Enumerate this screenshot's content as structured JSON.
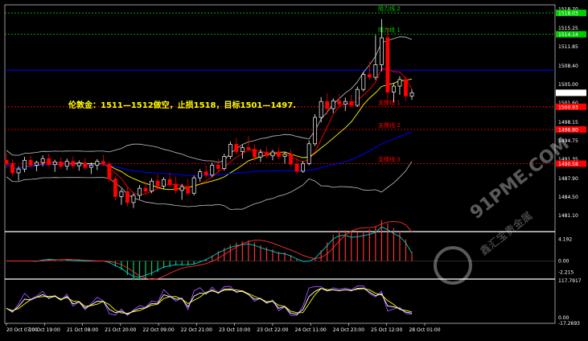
{
  "annotation": "伦敦金：1511—1512做空，止损1518，目标1501—1497.",
  "watermark": {
    "brand": "91PME.COM",
    "sub": "鑫汇宝贵金属"
  },
  "colors": {
    "background": "#000000",
    "bull": "#ffffff",
    "bear": "#ff0000",
    "resistance": "#00cc00",
    "support": "#ff0000",
    "blue_level": "#0000ff",
    "bollinger": "#c0c0c0",
    "ma_fast": "#ff0000",
    "ma_mid": "#ffff00",
    "ma_slow": "#0000ff",
    "annotation": "#ffff00"
  },
  "chart_data": [
    {
      "type": "candlestick",
      "ylim": [
        1478.5,
        1519.5
      ],
      "y_ticks": [
        "1518.70",
        "1515.25",
        "1511.85",
        "1508.40",
        "1505.00",
        "1501.60",
        "1498.15",
        "1494.75",
        "1491.35",
        "1487.90",
        "1484.50",
        "1481.10"
      ],
      "y_tick_values": [
        1518.7,
        1515.25,
        1511.85,
        1508.4,
        1505.0,
        1501.6,
        1498.15,
        1494.75,
        1491.35,
        1487.9,
        1484.5,
        1481.1
      ],
      "price_badges": [
        {
          "text": "1518.03",
          "value": 1518.03,
          "color": "#00cc00"
        },
        {
          "text": "1514.14",
          "value": 1514.14,
          "color": "#00cc00"
        },
        {
          "text": "1503.48",
          "value": 1503.48,
          "color": "#ffffff"
        },
        {
          "text": "1500.93",
          "value": 1500.93,
          "color": "#ff0000"
        },
        {
          "text": "1496.80",
          "value": 1496.8,
          "color": "#ff0000"
        },
        {
          "text": "1490.58",
          "value": 1490.58,
          "color": "#ff0000"
        }
      ],
      "levels": [
        {
          "name": "阻力线 2",
          "value": 1518.03,
          "color": "#00cc00"
        },
        {
          "name": "阻力线 1",
          "value": 1514.14,
          "color": "#00cc00"
        },
        {
          "name": "",
          "value": 1507.6,
          "color": "#0000ff"
        },
        {
          "name": "支撑线 1",
          "value": 1500.93,
          "color": "#ff0000"
        },
        {
          "name": "支撑线 2",
          "value": 1496.8,
          "color": "#ff0000"
        },
        {
          "name": "支撑线 3",
          "value": 1490.58,
          "color": "#ff0000"
        }
      ],
      "x_labels": [
        "20 Oct 07:00",
        "20 Oct 19:00",
        "21 Oct 08:00",
        "21 Oct 20:00",
        "22 Oct 09:00",
        "22 Oct 21:00",
        "23 Oct 10:00",
        "23 Oct 22:00",
        "24 Oct 11:00",
        "24 Oct 23:00",
        "25 Oct 12:00",
        "28 Oct 01:00"
      ],
      "ohlc": [
        [
          1491.2,
          1492.5,
          1489.8,
          1490.6
        ],
        [
          1490.6,
          1491.4,
          1488.2,
          1488.9
        ],
        [
          1488.9,
          1490.1,
          1487.5,
          1489.6
        ],
        [
          1489.6,
          1491.8,
          1489.0,
          1491.2
        ],
        [
          1491.2,
          1492.0,
          1489.9,
          1490.3
        ],
        [
          1490.3,
          1491.1,
          1489.2,
          1490.8
        ],
        [
          1490.8,
          1492.1,
          1490.1,
          1491.5
        ],
        [
          1491.5,
          1492.4,
          1490.0,
          1490.4
        ],
        [
          1490.4,
          1491.3,
          1489.1,
          1490.9
        ],
        [
          1490.9,
          1491.7,
          1489.6,
          1490.1
        ],
        [
          1490.1,
          1491.5,
          1489.4,
          1491.0
        ],
        [
          1491.0,
          1491.9,
          1489.7,
          1490.2
        ],
        [
          1490.2,
          1491.2,
          1489.3,
          1490.7
        ],
        [
          1490.7,
          1491.6,
          1489.5,
          1489.9
        ],
        [
          1489.9,
          1490.8,
          1488.7,
          1490.3
        ],
        [
          1490.3,
          1491.4,
          1489.4,
          1491.0
        ],
        [
          1491.0,
          1492.2,
          1490.1,
          1490.5
        ],
        [
          1490.5,
          1490.9,
          1487.2,
          1487.8
        ],
        [
          1487.8,
          1488.4,
          1483.9,
          1484.6
        ],
        [
          1484.6,
          1486.0,
          1483.1,
          1485.5
        ],
        [
          1485.5,
          1486.3,
          1482.8,
          1483.5
        ],
        [
          1483.5,
          1485.2,
          1482.5,
          1484.8
        ],
        [
          1484.8,
          1486.7,
          1484.1,
          1486.1
        ],
        [
          1486.1,
          1487.3,
          1485.0,
          1485.6
        ],
        [
          1485.6,
          1487.9,
          1485.2,
          1487.4
        ],
        [
          1487.4,
          1488.6,
          1486.0,
          1486.5
        ],
        [
          1486.5,
          1488.1,
          1485.9,
          1487.7
        ],
        [
          1487.7,
          1488.9,
          1486.3,
          1486.8
        ],
        [
          1486.8,
          1488.2,
          1485.1,
          1485.7
        ],
        [
          1485.7,
          1486.9,
          1484.0,
          1486.4
        ],
        [
          1486.4,
          1487.8,
          1484.9,
          1485.2
        ],
        [
          1485.2,
          1488.4,
          1484.8,
          1488.0
        ],
        [
          1488.0,
          1489.6,
          1487.3,
          1489.1
        ],
        [
          1489.1,
          1490.3,
          1488.0,
          1488.5
        ],
        [
          1488.5,
          1490.8,
          1488.1,
          1490.3
        ],
        [
          1490.3,
          1491.5,
          1489.2,
          1489.7
        ],
        [
          1489.7,
          1492.4,
          1489.3,
          1491.9
        ],
        [
          1491.9,
          1494.6,
          1491.4,
          1494.1
        ],
        [
          1494.1,
          1495.3,
          1492.2,
          1492.8
        ],
        [
          1492.8,
          1494.0,
          1491.5,
          1493.5
        ],
        [
          1493.5,
          1495.6,
          1492.9,
          1493.2
        ],
        [
          1493.2,
          1494.1,
          1491.1,
          1491.8
        ],
        [
          1491.8,
          1493.2,
          1490.9,
          1492.6
        ],
        [
          1492.6,
          1493.7,
          1491.6,
          1492.0
        ],
        [
          1492.0,
          1493.1,
          1491.2,
          1492.7
        ],
        [
          1492.7,
          1493.5,
          1491.4,
          1491.9
        ],
        [
          1491.9,
          1492.8,
          1490.6,
          1492.3
        ],
        [
          1492.3,
          1493.2,
          1490.1,
          1490.5
        ],
        [
          1490.5,
          1491.6,
          1488.7,
          1489.2
        ],
        [
          1489.2,
          1491.1,
          1488.9,
          1490.6
        ],
        [
          1490.6,
          1494.8,
          1490.3,
          1494.2
        ],
        [
          1494.2,
          1499.6,
          1493.8,
          1499.0
        ],
        [
          1499.0,
          1502.7,
          1498.1,
          1501.9
        ],
        [
          1501.9,
          1503.4,
          1499.5,
          1500.6
        ],
        [
          1500.6,
          1502.5,
          1499.8,
          1502.0
        ],
        [
          1502.0,
          1503.2,
          1500.9,
          1501.4
        ],
        [
          1501.4,
          1502.6,
          1500.2,
          1501.9
        ],
        [
          1501.9,
          1503.1,
          1500.8,
          1501.2
        ],
        [
          1501.2,
          1504.6,
          1500.9,
          1504.1
        ],
        [
          1504.1,
          1507.3,
          1503.7,
          1506.8
        ],
        [
          1506.8,
          1509.2,
          1505.9,
          1506.3
        ],
        [
          1506.3,
          1514.0,
          1505.8,
          1508.6
        ],
        [
          1508.6,
          1516.9,
          1507.4,
          1513.5
        ],
        [
          1513.5,
          1515.3,
          1502.4,
          1503.6
        ],
        [
          1503.6,
          1505.2,
          1501.8,
          1504.7
        ],
        [
          1504.7,
          1506.5,
          1503.1,
          1505.9
        ],
        [
          1505.9,
          1506.4,
          1502.0,
          1502.9
        ],
        [
          1502.9,
          1504.1,
          1502.2,
          1503.48
        ]
      ]
    },
    {
      "type": "histogram-lines",
      "name": "oscillator",
      "ylim": [
        -3.2,
        5.4
      ],
      "y_ticks": [
        "4.192",
        "0.00",
        "-2.215"
      ],
      "y_tick_values": [
        4.192,
        0.0,
        -2.215
      ]
    },
    {
      "type": "line",
      "name": "stochastic",
      "ylim": [
        -17.5,
        117.8
      ],
      "y_ticks": [
        "117.7917",
        "0.00",
        "-17.2693"
      ],
      "y_tick_values": [
        117.7917,
        0.0,
        -17.2693
      ]
    }
  ]
}
